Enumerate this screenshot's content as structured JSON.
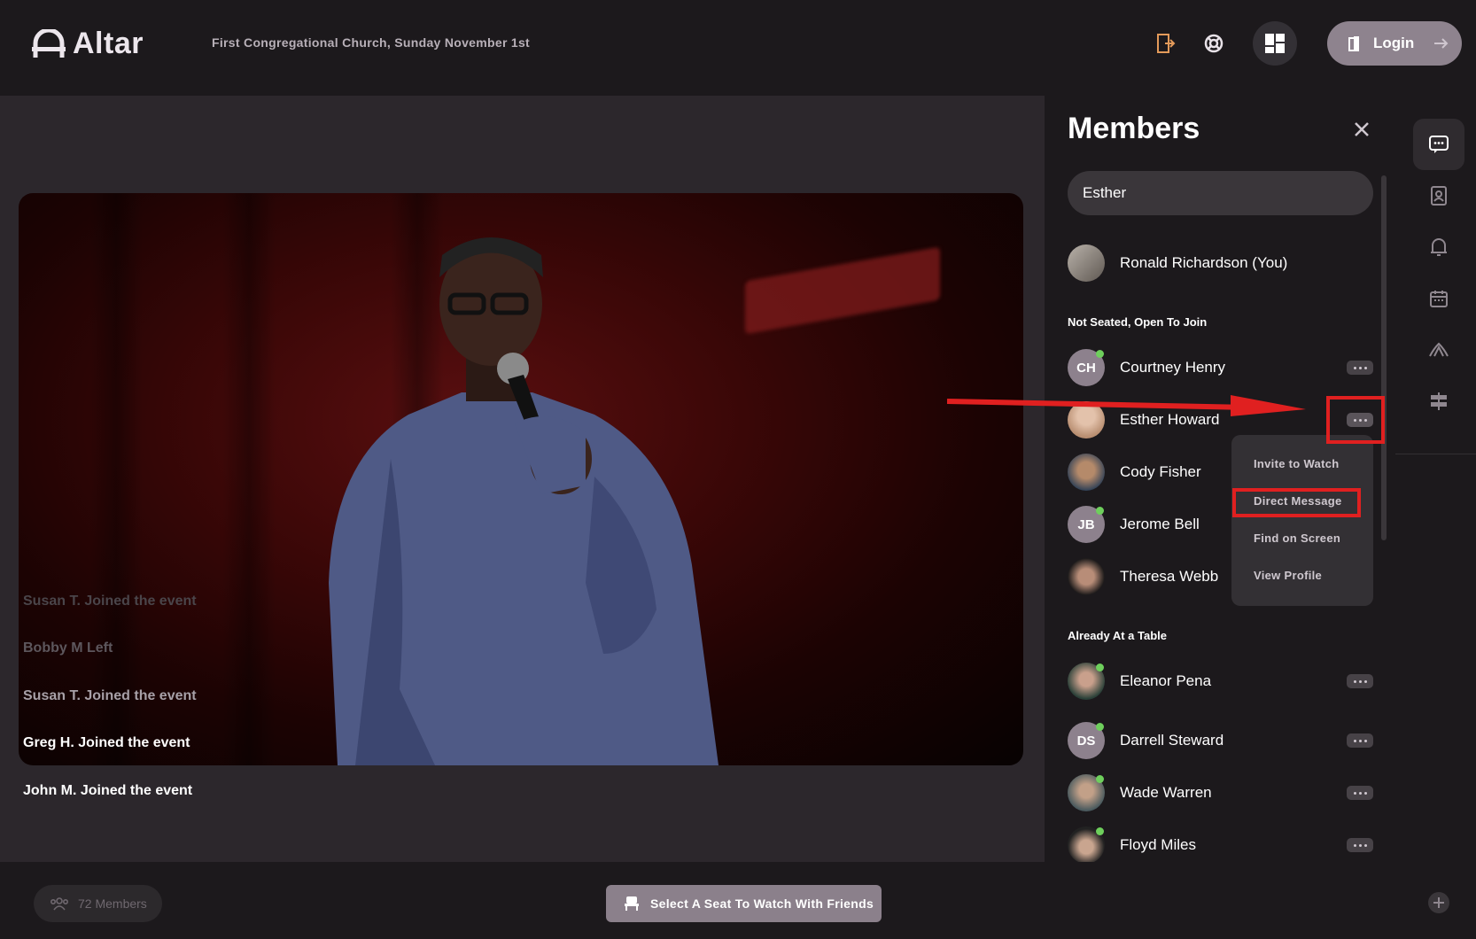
{
  "header": {
    "logo_text": "Altar",
    "event_title": "First Congregational Church, Sunday November 1st",
    "icons": [
      "exit-door-icon",
      "lifebuoy-icon",
      "layout-grid-icon"
    ],
    "login_label": "Login"
  },
  "stage": {
    "activity_feed": [
      "Susan T. Joined the event",
      "Bobby M Left",
      "Susan T. Joined the event",
      "Greg H.  Joined the event",
      "John M. Joined the event"
    ]
  },
  "members_panel": {
    "title": "Members",
    "search_value": "Esther",
    "self": {
      "name": "Ronald Richardson (You)"
    },
    "sections": [
      {
        "label": "Not Seated, Open To Join",
        "members": [
          {
            "name": "Courtney Henry",
            "initials": "CH",
            "online": true
          },
          {
            "name": "Esther Howard",
            "initials": "",
            "online": false
          },
          {
            "name": "Cody Fisher",
            "initials": "",
            "online": false
          },
          {
            "name": "Jerome Bell",
            "initials": "JB",
            "online": true
          },
          {
            "name": "Theresa Webb",
            "initials": "",
            "online": false
          }
        ]
      },
      {
        "label": "Already At a Table",
        "members": [
          {
            "name": "Eleanor Pena",
            "initials": "",
            "online": true
          },
          {
            "name": "Darrell Steward",
            "initials": "DS",
            "online": true
          },
          {
            "name": "Wade Warren",
            "initials": "",
            "online": true
          },
          {
            "name": "Floyd Miles",
            "initials": "",
            "online": true
          }
        ]
      }
    ],
    "context_menu": [
      "Invite to Watch",
      "Direct Message",
      "Find on Screen",
      "View Profile"
    ]
  },
  "right_rail": {
    "icons": [
      "chat-icon",
      "contacts-icon",
      "bell-icon",
      "calendar-icon",
      "prayer-hands-icon",
      "signpost-icon"
    ]
  },
  "footer": {
    "members_count_label": "72 Members",
    "seat_button_label": "Select A Seat To Watch With Friends"
  },
  "colors": {
    "background": "#1c191c",
    "stage": "#2c272c",
    "accent_button": "#8e838e",
    "annotation_red": "#e02020",
    "online_green": "#6ecf5c"
  }
}
